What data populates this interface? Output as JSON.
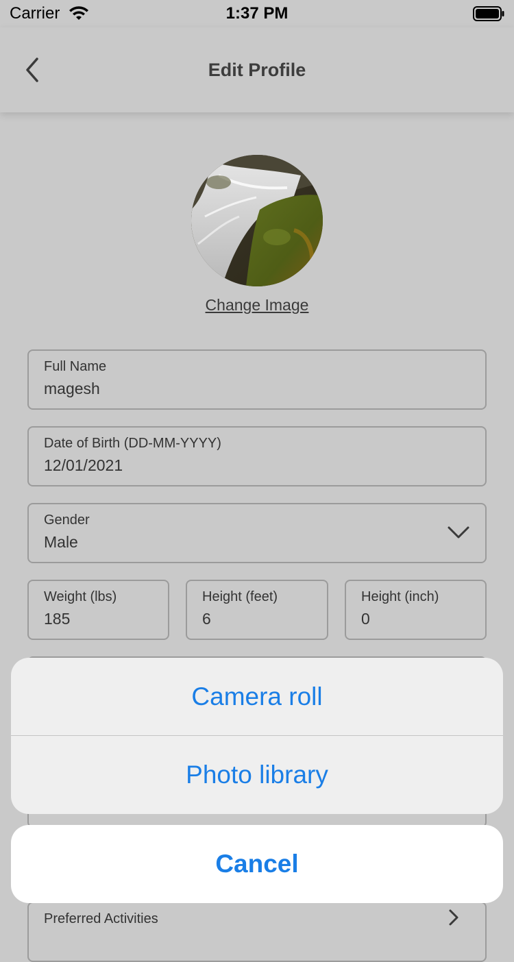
{
  "status_bar": {
    "carrier": "Carrier",
    "time": "1:37 PM"
  },
  "header": {
    "title": "Edit Profile"
  },
  "avatar": {
    "change_label": "Change Image"
  },
  "fields": {
    "full_name": {
      "label": "Full Name",
      "value": "magesh"
    },
    "dob": {
      "label": "Date of Birth (DD-MM-YYYY)",
      "value": "12/01/2021"
    },
    "gender": {
      "label": "Gender",
      "value": "Male"
    },
    "weight": {
      "label": "Weight (lbs)",
      "value": "185"
    },
    "height_feet": {
      "label": "Height (feet)",
      "value": "6"
    },
    "height_inch": {
      "label": "Height (inch)",
      "value": "0"
    },
    "activities": {
      "label": "Preferred Activities"
    }
  },
  "action_sheet": {
    "camera_roll": "Camera roll",
    "photo_library": "Photo library",
    "cancel": "Cancel"
  },
  "colors": {
    "accent": "#1a7ee6",
    "dim_background": "#c9c9c9"
  }
}
